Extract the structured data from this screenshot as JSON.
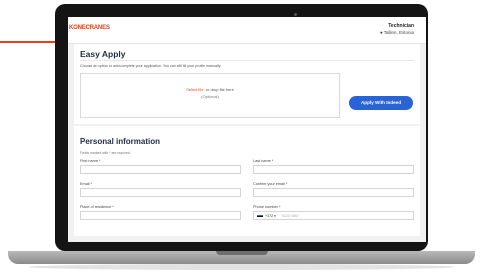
{
  "header": {
    "logo_text": "KONECRANES",
    "job_title": "Technician",
    "location": "Tallinn, Estonia"
  },
  "easy_apply": {
    "title": "Easy Apply",
    "description": "Choose an option to autocomplete your application. You can still fill your profile manually.",
    "dropzone_link": "Select file,",
    "dropzone_text": "or drop file here",
    "dropzone_optional": "(Optional)",
    "indeed_button": "Apply With Indeed"
  },
  "personal_info": {
    "title": "Personal information",
    "required_note": "Fields marked with * are required.",
    "fields": {
      "first_name": {
        "label": "First name *",
        "value": ""
      },
      "last_name": {
        "label": "Last name *",
        "value": ""
      },
      "email": {
        "label": "Email *",
        "value": ""
      },
      "confirm_email": {
        "label": "Confirm your email *",
        "value": ""
      },
      "place_of_residence": {
        "label": "Place of residence *",
        "value": ""
      },
      "phone": {
        "label": "Phone number *",
        "dial_code": "+372",
        "placeholder": "5123 4567"
      }
    }
  },
  "colors": {
    "brand": "#e8401d",
    "primary_button": "#2a63d6",
    "heading": "#1f2a44"
  },
  "icons": [
    "location-pin-icon",
    "flag-estonia-icon",
    "chevron-down-icon"
  ]
}
